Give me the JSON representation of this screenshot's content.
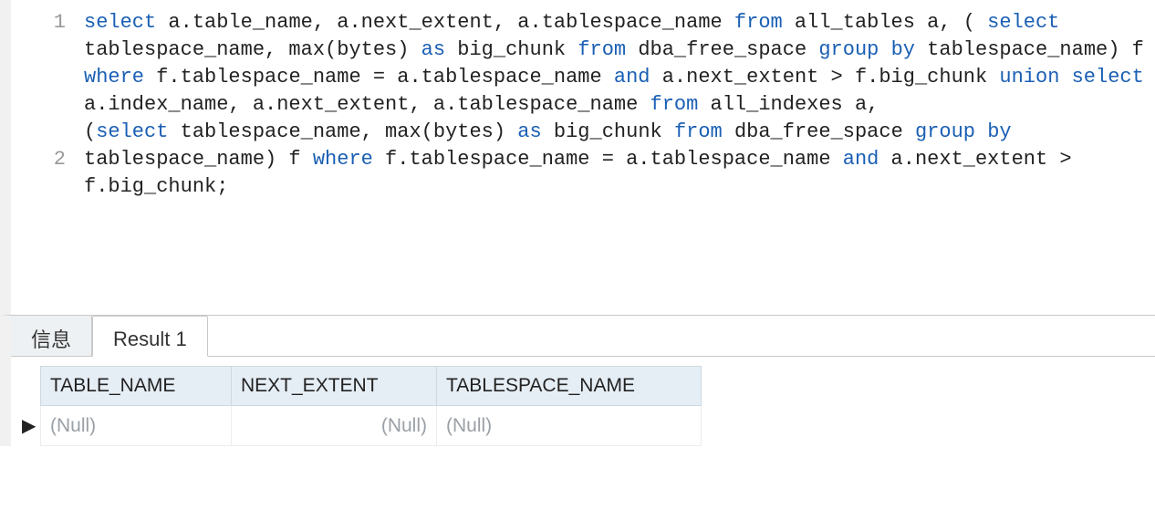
{
  "editor": {
    "lines": [
      {
        "num": "1",
        "tokens": [
          {
            "t": "select",
            "k": true
          },
          {
            "t": " a.table_name, a.next_extent, a.tablespace_name "
          },
          {
            "t": "from",
            "k": true
          },
          {
            "t": " all_tables a, ( "
          },
          {
            "t": "select",
            "k": true
          },
          {
            "t": " tablespace_name, max(bytes) "
          },
          {
            "t": "as",
            "k": true
          },
          {
            "t": " big_chunk "
          },
          {
            "t": "from",
            "k": true
          },
          {
            "t": " dba_free_space "
          },
          {
            "t": "group by",
            "k": true
          },
          {
            "t": " tablespace_name) f "
          },
          {
            "t": "where",
            "k": true
          },
          {
            "t": " f.tablespace_name = a.tablespace_name "
          },
          {
            "t": "and",
            "k": true
          },
          {
            "t": " a.next_extent > f.big_chunk "
          },
          {
            "t": "union",
            "k": true
          },
          {
            "t": " "
          },
          {
            "t": "select",
            "k": true
          },
          {
            "t": " a.index_name, a.next_extent, a.tablespace_name "
          },
          {
            "t": "from",
            "k": true
          },
          {
            "t": " all_indexes a,"
          }
        ],
        "wrap_rows": 5
      },
      {
        "num": "2",
        "tokens": [
          {
            "t": "("
          },
          {
            "t": "select",
            "k": true
          },
          {
            "t": " tablespace_name, max(bytes) "
          },
          {
            "t": "as",
            "k": true
          },
          {
            "t": " big_chunk "
          },
          {
            "t": "from",
            "k": true
          },
          {
            "t": " dba_free_space "
          },
          {
            "t": "group by",
            "k": true
          },
          {
            "t": " tablespace_name) f "
          },
          {
            "t": "where",
            "k": true
          },
          {
            "t": " f.tablespace_name = a.tablespace_name "
          },
          {
            "t": "and",
            "k": true
          },
          {
            "t": " a.next_extent > f.big_chunk;"
          }
        ],
        "wrap_rows": 3
      }
    ]
  },
  "tabs": {
    "info_label": "信息",
    "result_label": "Result 1"
  },
  "grid": {
    "columns": [
      "TABLE_NAME",
      "NEXT_EXTENT",
      "TABLESPACE_NAME"
    ],
    "row_indicator_glyph": "▶",
    "rows": [
      {
        "table_name": "(Null)",
        "next_extent": "(Null)",
        "tablespace_name": "(Null)"
      }
    ]
  }
}
